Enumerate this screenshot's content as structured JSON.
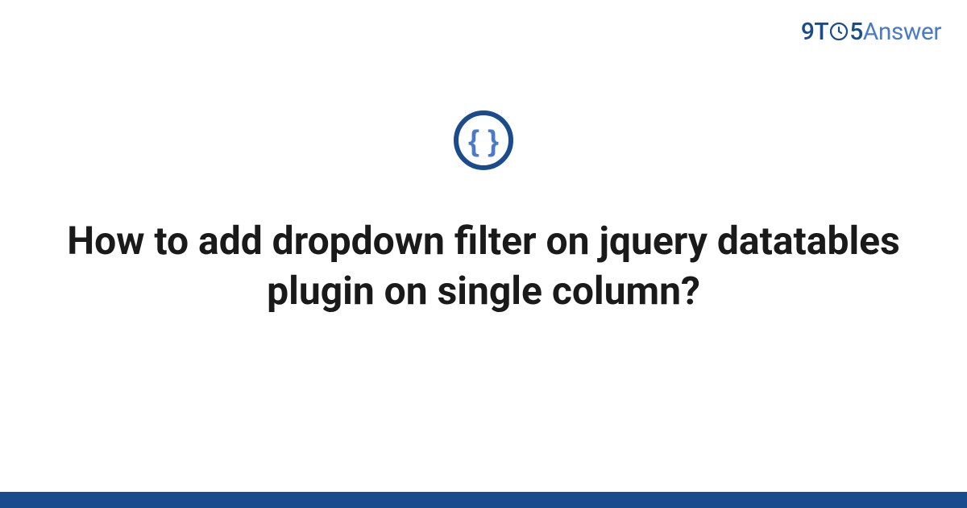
{
  "logo": {
    "part1": "9",
    "part2": "T",
    "part3": "5",
    "part4": "Answer"
  },
  "icon": {
    "name": "braces-icon"
  },
  "title": "How to add dropdown filter on jquery datatables plugin on single column?",
  "colors": {
    "primary": "#1a4b8c",
    "secondary": "#4a7bc8",
    "text": "#1a1a1a"
  }
}
